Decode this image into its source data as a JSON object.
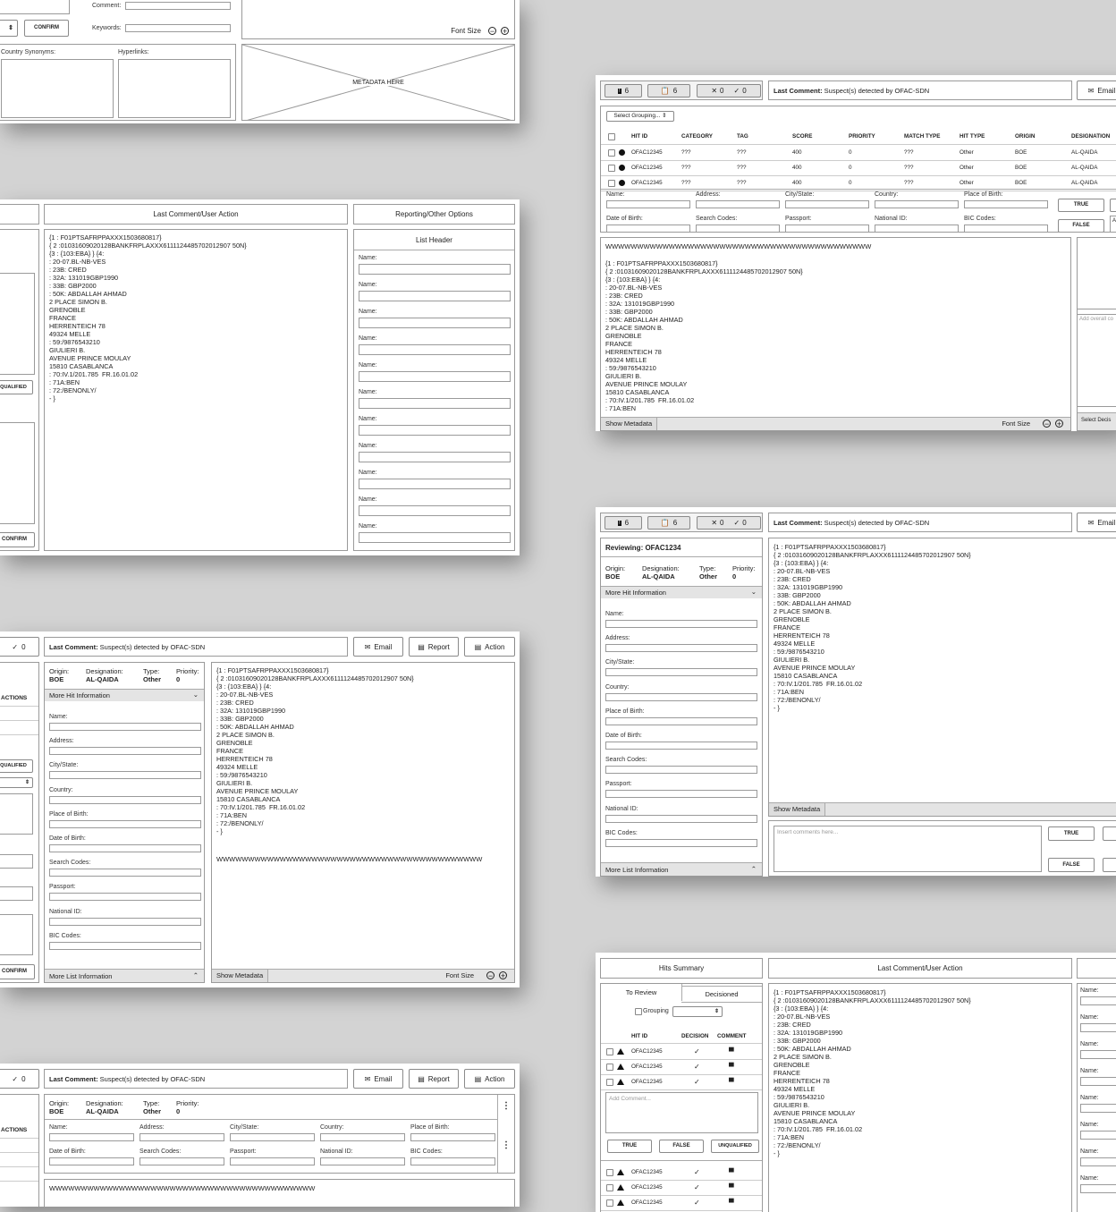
{
  "counts": {
    "flag": "6",
    "clipboard": "6",
    "x": "0",
    "check": "0"
  },
  "last_comment": {
    "label": "Last Comment:",
    "text": " Suspect(s) detected by OFAC-SDN"
  },
  "actions": {
    "email": "Email",
    "report": "Report",
    "action": "Action"
  },
  "panels": {
    "last_comment_user_action": "Last Comment/User Action",
    "reporting_other": "Reporting/Other Options",
    "list_header": "List Header",
    "hits_summary": "Hits Summary",
    "metadata_here": "METADATA HERE"
  },
  "fields": {
    "comment": "Comment:",
    "keywords": "Keywords:",
    "country_synonyms": "Country Synonyms:",
    "hyperlinks": "Hyperlinks:",
    "name": "Name:",
    "address": "Address:",
    "city_state": "City/State:",
    "country": "Country:",
    "place_of_birth": "Place of Birth:",
    "date_of_birth": "Date of Birth:",
    "search_codes": "Search Codes:",
    "passport": "Passport:",
    "national_id": "National ID:",
    "bic_codes": "BIC Codes:"
  },
  "buttons": {
    "confirm": "CONFIRM",
    "true": "TRUE",
    "false": "FALSE",
    "unqualified": "UNQUALIFIED",
    "qualified": "QUALIFIED",
    "actions": "ACTIONS",
    "show_metadata": "Show Metadata",
    "font_size": "Font Size",
    "more_hit": "More Hit Information",
    "more_list": "More List Information",
    "select_grouping": "Select Grouping...",
    "select_decision": "Select Decis",
    "grouping": "Grouping",
    "to_review": "To Review",
    "decisioned": "Decisioned"
  },
  "placeholders": {
    "add_overall": "Add overall co",
    "insert_comments": "Insert comments here...",
    "add_comment": "Add Comment..."
  },
  "meta": {
    "origin_label": "Origin:",
    "origin": "BOE",
    "designation_label": "Designation:",
    "designation": "AL-QAIDA",
    "type_label": "Type:",
    "type": "Other",
    "priority_label": "Priority:",
    "priority": "0",
    "reviewing": "Reviewing: OFAC1234"
  },
  "table": {
    "headers": [
      "HIT ID",
      "CATEGORY",
      "TAG",
      "SCORE",
      "PRIORITY",
      "MATCH TYPE",
      "HIT TYPE",
      "ORIGIN",
      "DESIGNATION"
    ],
    "rows": [
      [
        "OFAC12345",
        "???",
        "???",
        "400",
        "0",
        "???",
        "Other",
        "BOE",
        "AL-QAIDA"
      ],
      [
        "OFAC12345",
        "???",
        "???",
        "400",
        "0",
        "???",
        "Other",
        "BOE",
        "AL-QAIDA"
      ],
      [
        "OFAC12345",
        "???",
        "???",
        "400",
        "0",
        "???",
        "Other",
        "BOE",
        "AL-QAIDA"
      ]
    ]
  },
  "summary": {
    "headers": [
      "HIT ID",
      "DECISION",
      "COMMENT"
    ],
    "rows": [
      "OFAC12345",
      "OFAC12345",
      "OFAC12345",
      "OFAC12345",
      "OFAC12345",
      "OFAC12345"
    ]
  },
  "wwww": "WWWWWWWWWWWWWWWWWWWWWWWWWWWWWWWWWWWWWWWWWW",
  "message": "{1 : F01PTSAFRPPAXXX1503680817}\n{ 2 :01031609020128BANKFRPLAXXX6111124485702012907 50N}\n{3 : {103:EBA} } {4:\n: 20-07.BL-NB-VES\n: 23B: CRED\n: 32A: 131019GBP1990\n: 33B: GBP2000\n: 50K: ABDALLAH AHMAD\n2 PLACE SIMON B.\nGRENOBLE\nFRANCE\nHERRENTEICH 78\n49324 MELLE\n: 59:/9876543210\nGIULIERI B.\nAVENUE PRINCE MOULAY\n15810 CASABLANCA\n: 70:IV.1/201.785  FR.16.01.02\n: 71A:BEN\n: 72:/BENONLY/\n- }",
  "message_short": "{1 : F01PTSAFRPPAXXX1503680817}\n{ 2 :01031609020128BANKFRPLAXXX6111124485702012907 50N}\n{3 : {103:EBA} } {4:\n: 20-07.BL-NB-VES\n: 23B: CRED\n: 32A: 131019GBP1990\n: 33B: GBP2000\n: 50K: ABDALLAH AHMAD\n2 PLACE SIMON B.\nGRENOBLE\nFRANCE\nHERRENTEICH 78\n49324 MELLE\n: 59:/9876543210\nGIULIERI B.\nAVENUE PRINCE MOULAY\n15810 CASABLANCA\n: 70:IV.1/201.785  FR.16.01.02\n: 71A:BEN"
}
